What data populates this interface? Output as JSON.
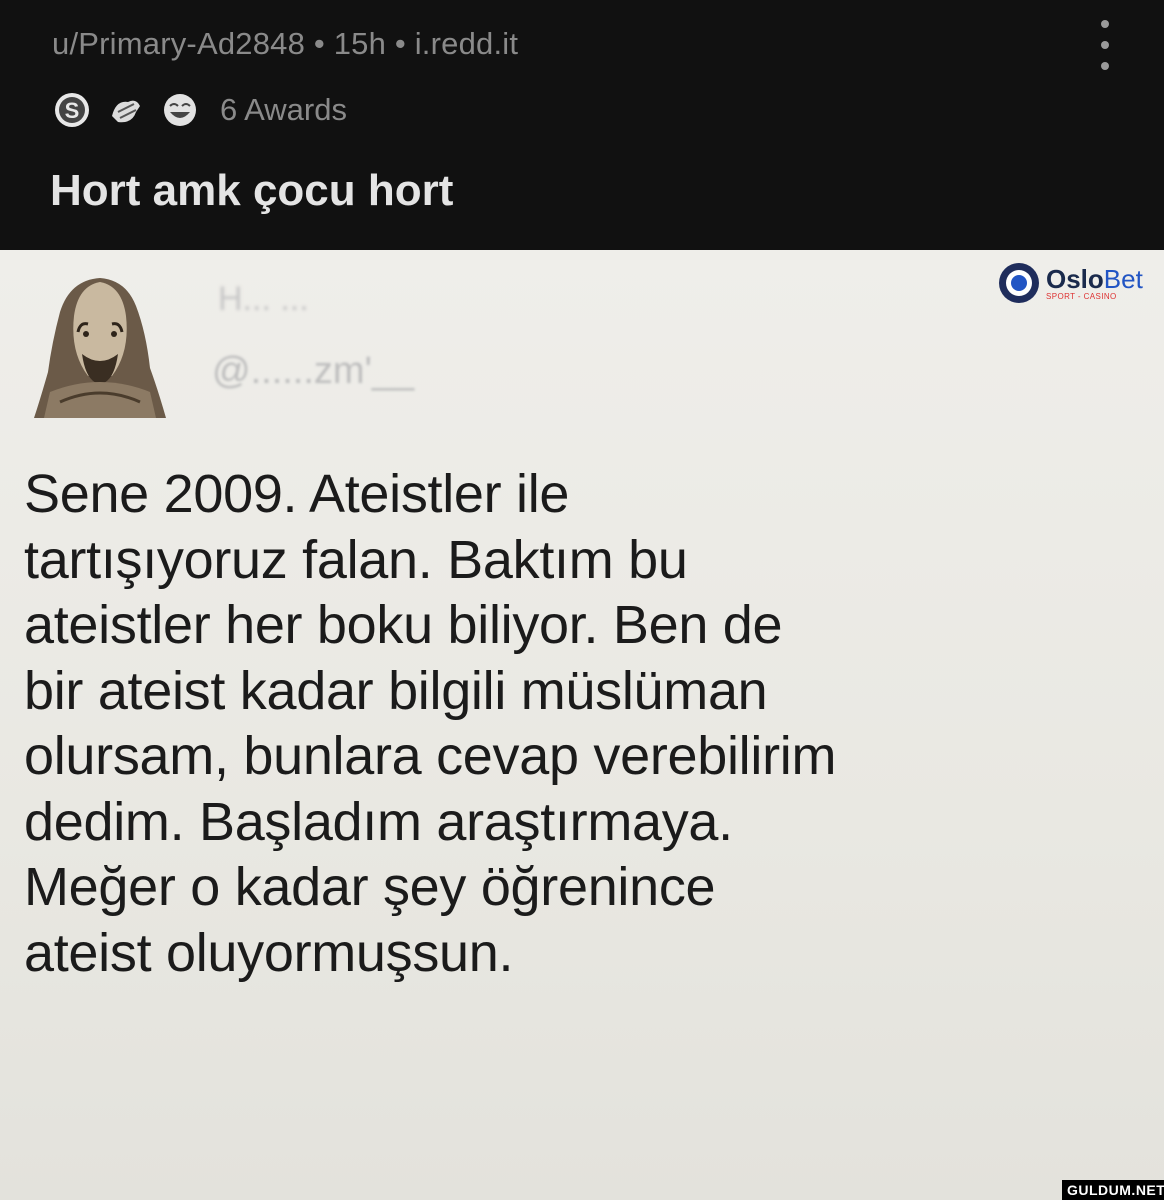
{
  "post": {
    "meta": "u/Primary-Ad2848 • 15h • i.redd.it",
    "awards_label": "6 Awards",
    "award_icons": [
      "silver-award-icon",
      "wholesome-award-icon",
      "laughing-award-icon"
    ],
    "title": "Hort amk çocu hort"
  },
  "image": {
    "blurred_name": "H... ...",
    "blurred_handle": "@......zm'__",
    "logo": {
      "name_part1": "Oslo",
      "name_part2": "Bet",
      "sub": "SPORT - CASINO"
    },
    "tweet_lines": [
      "Sene 2009. Ateistler ile",
      "tartışıyoruz falan. Baktım bu",
      "ateistler her boku biliyor. Ben de",
      "bir ateist kadar bilgili müslüman",
      "olursam, bunlara cevap verebilirim",
      "dedim. Başladım araştırmaya.",
      "Meğer o kadar şey öğrenince",
      "ateist oluyormuşsun."
    ],
    "watermark": "GULDUM.NET"
  },
  "colors": {
    "header_bg": "#111111",
    "meta_text": "#8a8a8a",
    "title_text": "#e4e4e4",
    "post_bg": "#ecebe6",
    "tweet_text": "#1b1b1b"
  }
}
